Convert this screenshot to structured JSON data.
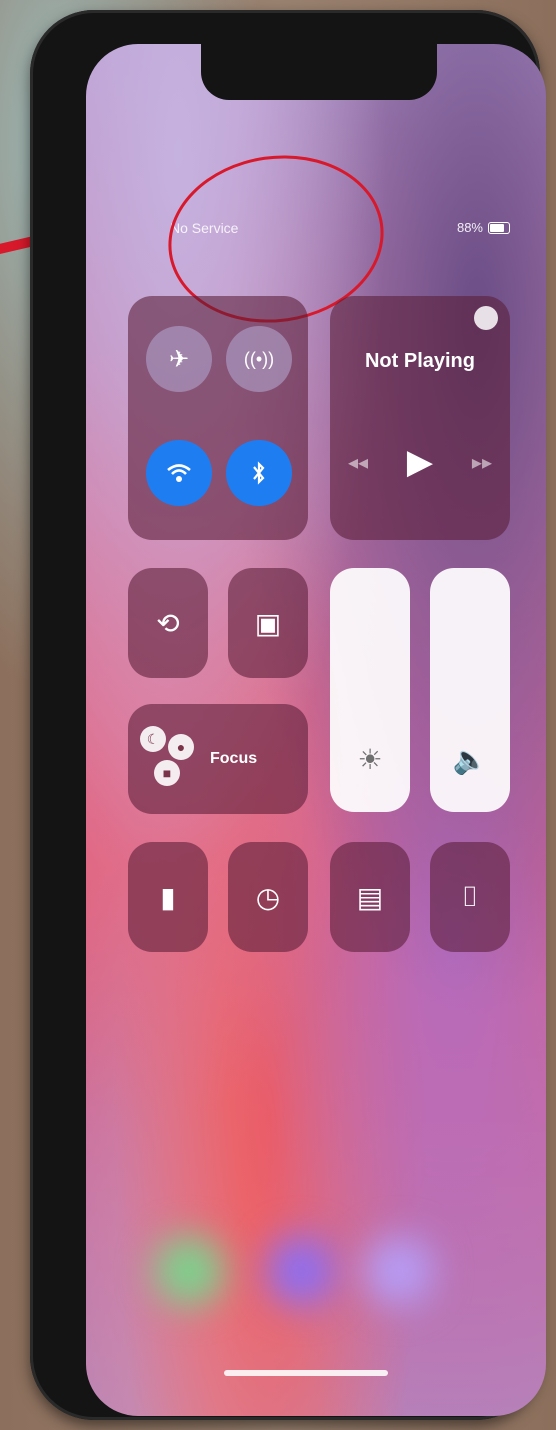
{
  "status_bar": {
    "carrier": "No Service",
    "battery_percent": "88%"
  },
  "connectivity": {
    "airplane_icon": "airplane-icon",
    "cellular_icon": "cellular-antenna-icon",
    "wifi_icon": "wifi-icon",
    "bluetooth_icon": "bluetooth-icon"
  },
  "media": {
    "title": "Not Playing",
    "rewind": "◂◂",
    "play": "▶",
    "forward": "▸▸",
    "airplay_icon": "airplay-icon"
  },
  "controls": {
    "orientation_lock_icon": "lock-rotation-icon",
    "screen_mirroring_icon": "screen-mirroring-icon",
    "focus": {
      "label": "Focus",
      "icon": "focus-icon"
    },
    "brightness_icon": "sun-icon",
    "volume_icon": "speaker-icon",
    "flashlight_icon": "flashlight-icon",
    "timer_icon": "timer-icon",
    "calculator_icon": "calculator-icon",
    "camera_icon": "camera-icon"
  },
  "annotation": {
    "circle_color": "#d8192b",
    "arrow_color": "#d8192b"
  }
}
